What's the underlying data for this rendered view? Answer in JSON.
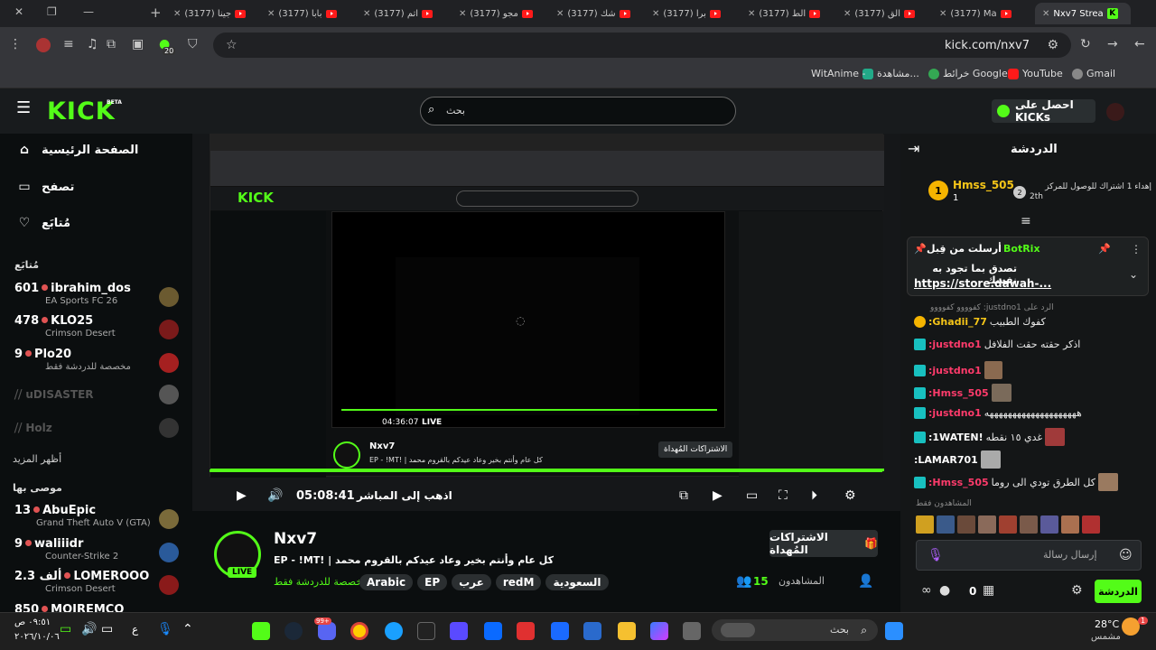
{
  "browser": {
    "tabs": [
      {
        "label": "(3177) جينا"
      },
      {
        "label": "(3177) بابا"
      },
      {
        "label": "(3177) اتم"
      },
      {
        "label": "(3177) مجو"
      },
      {
        "label": "(3177) شك"
      },
      {
        "label": "(3177) برا"
      },
      {
        "label": "(3177) الط"
      },
      {
        "label": "(3177) الق"
      },
      {
        "label": "(3177) Ma"
      },
      {
        "label": "Nxv7 Strea"
      }
    ],
    "url": "kick.com/nxv7",
    "extension_badge": "20",
    "bookmarks": [
      "Gmail",
      "YouTube",
      "خرائط Google",
      "مشاهدة...",
      "WitAnime -"
    ]
  },
  "kick": {
    "logo": "KICK",
    "beta": "BETA",
    "search_placeholder": "بحث",
    "get_kicks": "احصل على KICKs",
    "nav": [
      "الصفحة الرئيسية",
      "تصفح",
      "مُتابَع"
    ],
    "following_heading": "مُتابَع",
    "channels": [
      {
        "name": "ibrahim_dos",
        "viewers": "601",
        "game": "EA Sports FC 26"
      },
      {
        "name": "KLO25",
        "viewers": "478",
        "game": "Crimson Desert"
      },
      {
        "name": "Plo20",
        "viewers": "9",
        "game": "مخصصة للدردشة فقط"
      }
    ],
    "offline": [
      "uDISASTER",
      "Holz"
    ],
    "show_more": "أظهر المزيد",
    "recommended_heading": "موصى بها",
    "recommended": [
      {
        "name": "AbuEpic",
        "viewers": "13",
        "game": "Grand Theft Auto V (GTA)"
      },
      {
        "name": "waliiidr",
        "viewers": "9",
        "game": "Counter-Strike 2"
      },
      {
        "name": "LOMEROOO",
        "viewers": "2.3 ألف",
        "game": "Crimson Desert"
      },
      {
        "name": "MOJREMCO",
        "viewers": "850",
        "game": ""
      }
    ]
  },
  "player": {
    "time": "05:08:41",
    "live_button": "اذهب إلى المباشر",
    "inner_time": "04:36:07",
    "inner_live": "LIVE",
    "inner_name": "Nxv7",
    "inner_title": "كل عام وأنتم بخير وعاد عيدكم بالقروم محمد | !EP - !MT",
    "inner_subs": "الاشتراكات المُهداة"
  },
  "stream": {
    "streamer": "Nxv7",
    "title": "كل عام وأنتم بخير وعاد عيدكم بالقروم محمد | !EP - !MT",
    "category": "مخصصة للدردشة فقط",
    "tags": [
      "السعودية",
      "redM",
      "عرب",
      "EP",
      "Arabic"
    ],
    "viewers_label": "المشاهدون",
    "viewers": "15",
    "live": "LIVE",
    "gift_subs": "الاشتراكات المُهداة"
  },
  "chat": {
    "title": "الدردشة",
    "leader_name": "Hmss_505",
    "leader_count": "1",
    "leader_rank": "2",
    "leader_text": "إهداء 1 اشتراك للوصول للمركز",
    "leader_rank_label": "2th",
    "pinned_by": "أرسلت من قِبل",
    "pinned_user": "BotRix",
    "pinned_text": "تصدق بما تجود به نفسك",
    "pinned_link": "https://store.dawah-...",
    "reply_hint": "الرد على justdno1: كفوووو كفوووو",
    "messages": [
      {
        "user": "Ghadii_77:",
        "text": "كفوك الطبيب",
        "color": "#f5c518"
      },
      {
        "user": "justdno1:",
        "text": "اذكر حقته حقت الفلافل",
        "color": "#ff3b6b"
      },
      {
        "user": "justdno1:",
        "text": "",
        "color": "#ff3b6b"
      },
      {
        "user": "Hmss_505:",
        "text": "",
        "color": "#ff3b6b"
      },
      {
        "user": "justdno1:",
        "text": "ههههههههههههههههههههه",
        "color": "#ff3b6b"
      },
      {
        "user": "!1WATEN:",
        "text": "غدي ١٥ نقطه",
        "color": "#e0e0e0"
      },
      {
        "user": "LAMAR701:",
        "text": "",
        "color": "#e0e0e0"
      },
      {
        "user": "Hmss_505:",
        "text": "كل الطرق تودي الى روما",
        "color": "#ff3b6b"
      }
    ],
    "viewers_label": "المشاهدون فقط",
    "input_placeholder": "إرسال رسالة",
    "send": "الدردشة",
    "points": "0"
  },
  "taskbar": {
    "search": "بحث",
    "weather_temp": "28°C",
    "weather_desc": "مشمس",
    "time": "٠٩:٥١ ص",
    "date": "٢٠٢٦/١٠/٠٦",
    "lang": "ع",
    "notif": "1",
    "discord_badge": "99+"
  },
  "colors": {
    "accent": "#53fc18",
    "bg": "#0b0e0f",
    "panel": "#141617"
  }
}
